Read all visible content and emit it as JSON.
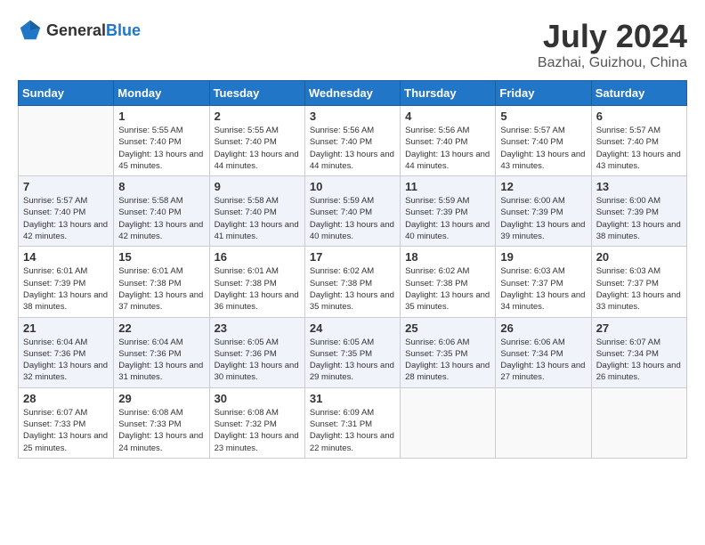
{
  "header": {
    "logo_general": "General",
    "logo_blue": "Blue",
    "title": "July 2024",
    "location": "Bazhai, Guizhou, China"
  },
  "days_of_week": [
    "Sunday",
    "Monday",
    "Tuesday",
    "Wednesday",
    "Thursday",
    "Friday",
    "Saturday"
  ],
  "weeks": [
    [
      {
        "day": "",
        "sunrise": "",
        "sunset": "",
        "daylight": ""
      },
      {
        "day": "1",
        "sunrise": "Sunrise: 5:55 AM",
        "sunset": "Sunset: 7:40 PM",
        "daylight": "Daylight: 13 hours and 45 minutes."
      },
      {
        "day": "2",
        "sunrise": "Sunrise: 5:55 AM",
        "sunset": "Sunset: 7:40 PM",
        "daylight": "Daylight: 13 hours and 44 minutes."
      },
      {
        "day": "3",
        "sunrise": "Sunrise: 5:56 AM",
        "sunset": "Sunset: 7:40 PM",
        "daylight": "Daylight: 13 hours and 44 minutes."
      },
      {
        "day": "4",
        "sunrise": "Sunrise: 5:56 AM",
        "sunset": "Sunset: 7:40 PM",
        "daylight": "Daylight: 13 hours and 44 minutes."
      },
      {
        "day": "5",
        "sunrise": "Sunrise: 5:57 AM",
        "sunset": "Sunset: 7:40 PM",
        "daylight": "Daylight: 13 hours and 43 minutes."
      },
      {
        "day": "6",
        "sunrise": "Sunrise: 5:57 AM",
        "sunset": "Sunset: 7:40 PM",
        "daylight": "Daylight: 13 hours and 43 minutes."
      }
    ],
    [
      {
        "day": "7",
        "sunrise": "Sunrise: 5:57 AM",
        "sunset": "Sunset: 7:40 PM",
        "daylight": "Daylight: 13 hours and 42 minutes."
      },
      {
        "day": "8",
        "sunrise": "Sunrise: 5:58 AM",
        "sunset": "Sunset: 7:40 PM",
        "daylight": "Daylight: 13 hours and 42 minutes."
      },
      {
        "day": "9",
        "sunrise": "Sunrise: 5:58 AM",
        "sunset": "Sunset: 7:40 PM",
        "daylight": "Daylight: 13 hours and 41 minutes."
      },
      {
        "day": "10",
        "sunrise": "Sunrise: 5:59 AM",
        "sunset": "Sunset: 7:40 PM",
        "daylight": "Daylight: 13 hours and 40 minutes."
      },
      {
        "day": "11",
        "sunrise": "Sunrise: 5:59 AM",
        "sunset": "Sunset: 7:39 PM",
        "daylight": "Daylight: 13 hours and 40 minutes."
      },
      {
        "day": "12",
        "sunrise": "Sunrise: 6:00 AM",
        "sunset": "Sunset: 7:39 PM",
        "daylight": "Daylight: 13 hours and 39 minutes."
      },
      {
        "day": "13",
        "sunrise": "Sunrise: 6:00 AM",
        "sunset": "Sunset: 7:39 PM",
        "daylight": "Daylight: 13 hours and 38 minutes."
      }
    ],
    [
      {
        "day": "14",
        "sunrise": "Sunrise: 6:01 AM",
        "sunset": "Sunset: 7:39 PM",
        "daylight": "Daylight: 13 hours and 38 minutes."
      },
      {
        "day": "15",
        "sunrise": "Sunrise: 6:01 AM",
        "sunset": "Sunset: 7:38 PM",
        "daylight": "Daylight: 13 hours and 37 minutes."
      },
      {
        "day": "16",
        "sunrise": "Sunrise: 6:01 AM",
        "sunset": "Sunset: 7:38 PM",
        "daylight": "Daylight: 13 hours and 36 minutes."
      },
      {
        "day": "17",
        "sunrise": "Sunrise: 6:02 AM",
        "sunset": "Sunset: 7:38 PM",
        "daylight": "Daylight: 13 hours and 35 minutes."
      },
      {
        "day": "18",
        "sunrise": "Sunrise: 6:02 AM",
        "sunset": "Sunset: 7:38 PM",
        "daylight": "Daylight: 13 hours and 35 minutes."
      },
      {
        "day": "19",
        "sunrise": "Sunrise: 6:03 AM",
        "sunset": "Sunset: 7:37 PM",
        "daylight": "Daylight: 13 hours and 34 minutes."
      },
      {
        "day": "20",
        "sunrise": "Sunrise: 6:03 AM",
        "sunset": "Sunset: 7:37 PM",
        "daylight": "Daylight: 13 hours and 33 minutes."
      }
    ],
    [
      {
        "day": "21",
        "sunrise": "Sunrise: 6:04 AM",
        "sunset": "Sunset: 7:36 PM",
        "daylight": "Daylight: 13 hours and 32 minutes."
      },
      {
        "day": "22",
        "sunrise": "Sunrise: 6:04 AM",
        "sunset": "Sunset: 7:36 PM",
        "daylight": "Daylight: 13 hours and 31 minutes."
      },
      {
        "day": "23",
        "sunrise": "Sunrise: 6:05 AM",
        "sunset": "Sunset: 7:36 PM",
        "daylight": "Daylight: 13 hours and 30 minutes."
      },
      {
        "day": "24",
        "sunrise": "Sunrise: 6:05 AM",
        "sunset": "Sunset: 7:35 PM",
        "daylight": "Daylight: 13 hours and 29 minutes."
      },
      {
        "day": "25",
        "sunrise": "Sunrise: 6:06 AM",
        "sunset": "Sunset: 7:35 PM",
        "daylight": "Daylight: 13 hours and 28 minutes."
      },
      {
        "day": "26",
        "sunrise": "Sunrise: 6:06 AM",
        "sunset": "Sunset: 7:34 PM",
        "daylight": "Daylight: 13 hours and 27 minutes."
      },
      {
        "day": "27",
        "sunrise": "Sunrise: 6:07 AM",
        "sunset": "Sunset: 7:34 PM",
        "daylight": "Daylight: 13 hours and 26 minutes."
      }
    ],
    [
      {
        "day": "28",
        "sunrise": "Sunrise: 6:07 AM",
        "sunset": "Sunset: 7:33 PM",
        "daylight": "Daylight: 13 hours and 25 minutes."
      },
      {
        "day": "29",
        "sunrise": "Sunrise: 6:08 AM",
        "sunset": "Sunset: 7:33 PM",
        "daylight": "Daylight: 13 hours and 24 minutes."
      },
      {
        "day": "30",
        "sunrise": "Sunrise: 6:08 AM",
        "sunset": "Sunset: 7:32 PM",
        "daylight": "Daylight: 13 hours and 23 minutes."
      },
      {
        "day": "31",
        "sunrise": "Sunrise: 6:09 AM",
        "sunset": "Sunset: 7:31 PM",
        "daylight": "Daylight: 13 hours and 22 minutes."
      },
      {
        "day": "",
        "sunrise": "",
        "sunset": "",
        "daylight": ""
      },
      {
        "day": "",
        "sunrise": "",
        "sunset": "",
        "daylight": ""
      },
      {
        "day": "",
        "sunrise": "",
        "sunset": "",
        "daylight": ""
      }
    ]
  ]
}
